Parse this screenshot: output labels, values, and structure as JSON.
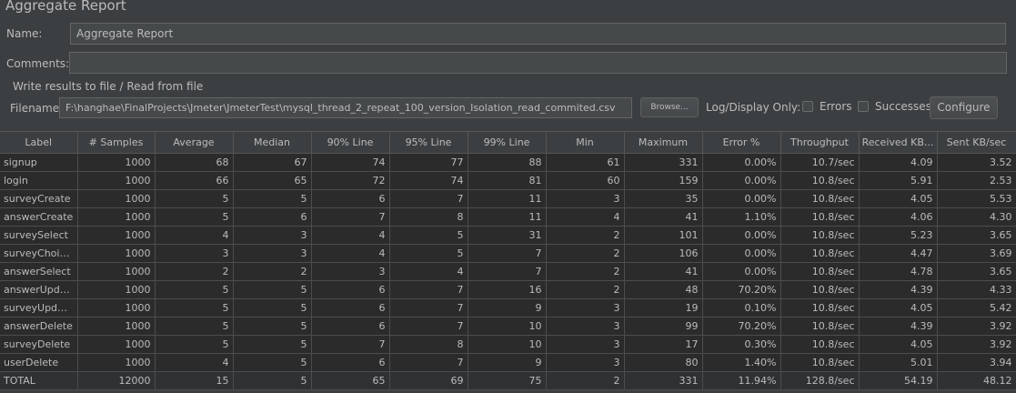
{
  "window_title": "Aggregate Report",
  "name": {
    "label": "Name:",
    "value": "Aggregate Report"
  },
  "comments": {
    "label": "Comments:",
    "value": ""
  },
  "file_group": {
    "title": "Write results to file / Read from file",
    "filename_label": "Filename",
    "filename_value": "F:\\hanghae\\FinalProjects\\Jmeter\\JmeterTest\\mysql_thread_2_repeat_100_version_Isolation_read_commited.csv",
    "browse_label": "Browse...",
    "log_display_label": "Log/Display Only:",
    "errors_label": "Errors",
    "successes_label": "Successes",
    "configure_label": "Configure"
  },
  "table": {
    "headers": [
      "Label",
      "# Samples",
      "Average",
      "Median",
      "90% Line",
      "95% Line",
      "99% Line",
      "Min",
      "Maximum",
      "Error %",
      "Throughput",
      "Received KB...",
      "Sent KB/sec"
    ],
    "rows": [
      [
        "signup",
        "1000",
        "68",
        "67",
        "74",
        "77",
        "88",
        "61",
        "331",
        "0.00%",
        "10.7/sec",
        "4.09",
        "3.52"
      ],
      [
        "login",
        "1000",
        "66",
        "65",
        "72",
        "74",
        "81",
        "60",
        "159",
        "0.00%",
        "10.8/sec",
        "5.91",
        "2.53"
      ],
      [
        "surveyCreate",
        "1000",
        "5",
        "5",
        "6",
        "7",
        "11",
        "3",
        "35",
        "0.00%",
        "10.8/sec",
        "4.05",
        "5.53"
      ],
      [
        "answerCreate",
        "1000",
        "5",
        "6",
        "7",
        "8",
        "11",
        "4",
        "41",
        "1.10%",
        "10.8/sec",
        "4.06",
        "4.30"
      ],
      [
        "surveySelect",
        "1000",
        "4",
        "3",
        "4",
        "5",
        "31",
        "2",
        "101",
        "0.00%",
        "10.8/sec",
        "5.23",
        "3.65"
      ],
      [
        "surveyChoic...",
        "1000",
        "3",
        "3",
        "4",
        "5",
        "7",
        "2",
        "106",
        "0.00%",
        "10.8/sec",
        "4.47",
        "3.69"
      ],
      [
        "answerSelect",
        "1000",
        "2",
        "2",
        "3",
        "4",
        "7",
        "2",
        "41",
        "0.00%",
        "10.8/sec",
        "4.78",
        "3.65"
      ],
      [
        "answerUpdate",
        "1000",
        "5",
        "5",
        "6",
        "7",
        "16",
        "2",
        "48",
        "70.20%",
        "10.8/sec",
        "4.39",
        "4.33"
      ],
      [
        "surveyUpdate",
        "1000",
        "5",
        "5",
        "6",
        "7",
        "9",
        "3",
        "19",
        "0.10%",
        "10.8/sec",
        "4.05",
        "5.42"
      ],
      [
        "answerDelete",
        "1000",
        "5",
        "5",
        "6",
        "7",
        "10",
        "3",
        "99",
        "70.20%",
        "10.8/sec",
        "4.39",
        "3.92"
      ],
      [
        "surveyDelete",
        "1000",
        "5",
        "5",
        "7",
        "8",
        "10",
        "3",
        "17",
        "0.30%",
        "10.8/sec",
        "4.05",
        "3.92"
      ],
      [
        "userDelete",
        "1000",
        "4",
        "5",
        "6",
        "7",
        "9",
        "3",
        "80",
        "1.40%",
        "10.8/sec",
        "5.01",
        "3.94"
      ],
      [
        "TOTAL",
        "12000",
        "15",
        "5",
        "65",
        "69",
        "75",
        "2",
        "331",
        "11.94%",
        "128.8/sec",
        "54.19",
        "48.12"
      ]
    ]
  }
}
